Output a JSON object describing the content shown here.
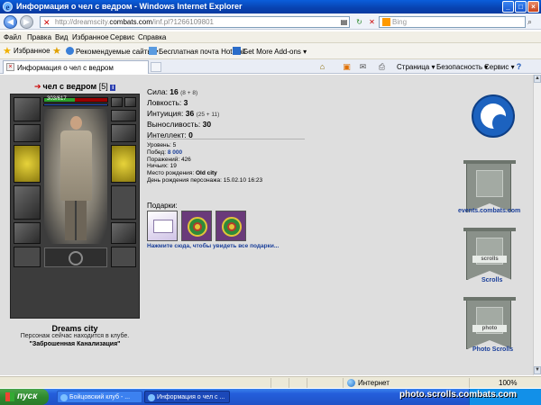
{
  "window": {
    "title": "Информация о чел с ведром - Windows Internet Explorer"
  },
  "address": {
    "url_prefix": "http://dreamscity.",
    "url_domain": "combats.com",
    "url_suffix": "/inf.pl?1266109801",
    "search_placeholder": "Bing"
  },
  "menu": [
    "Файл",
    "Правка",
    "Вид",
    "Избранное",
    "Сервис",
    "Справка"
  ],
  "favorites": {
    "label": "Избранное",
    "links": [
      "Рекомендуемые сайты ▾",
      "Бесплатная почта Hotmail",
      "Get More Add-ons ▾"
    ]
  },
  "tab": {
    "title": "Информация о чел с ведром"
  },
  "commands": [
    "Страница ▾",
    "Безопасность ▾",
    "Сервис ▾"
  ],
  "character": {
    "name": "чел с ведром",
    "level": "[5]",
    "info_badge": "i",
    "hp_text": "303/617",
    "hp_fraction": 0.49,
    "city": "Dreams city",
    "location_line": "Персонаж сейчас находится в клубе.",
    "location_name": "\"Заброшенная Канализация\""
  },
  "stats": [
    {
      "label": "Сила: ",
      "value": "16",
      "bonus": "(8 + 8)"
    },
    {
      "label": "Ловкость: ",
      "value": "3",
      "bonus": ""
    },
    {
      "label": "Интуиция: ",
      "value": "36",
      "bonus": "(25 + 11)"
    },
    {
      "label": "Выносливость: ",
      "value": "30",
      "bonus": ""
    },
    {
      "label": "Интеллект: ",
      "value": "0",
      "bonus": ""
    }
  ],
  "info": {
    "level": "Уровень: 5",
    "wins_label": "Побед: ",
    "wins_value": "8 000",
    "losses": "Поражений: 426",
    "draws": "Ничьих: 19",
    "birthplace_label": "Место рождения: ",
    "birthplace_value": "Old city",
    "birthday": "День рождения персонажа: 15.02.10 16:23"
  },
  "gifts": {
    "label": "Подарки:",
    "link": "Нажмите сюда, чтобы увидеть все подарки..."
  },
  "right_links": {
    "events": "events.combats.com",
    "scrolls": "Scrolls",
    "photo_scrolls": "Photo Scrolls",
    "banner_scrolls": "scrolls",
    "banner_photo": "photo"
  },
  "status": {
    "zone": "Интернет",
    "zoom": "100%"
  },
  "taskbar": {
    "start": "пуск",
    "buttons": [
      "Бойцовский клуб - ...",
      "Информация о чел с ..."
    ]
  },
  "watermark": "photo.scrolls.combats.com"
}
